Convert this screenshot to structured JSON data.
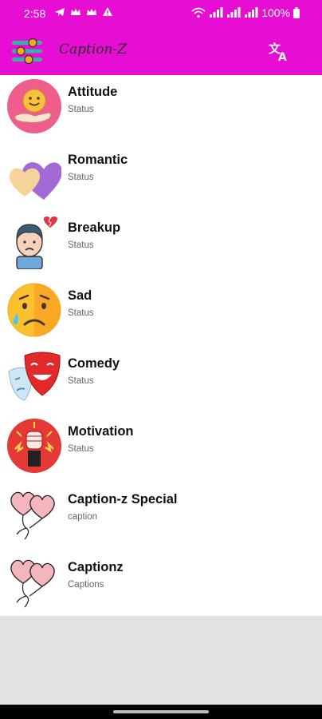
{
  "status_bar": {
    "time": "2:58",
    "battery": "100%"
  },
  "app_bar": {
    "title": "Caption-Z"
  },
  "list": [
    {
      "title": "Attitude",
      "subtitle": "Status",
      "icon": "smiley-hand-icon"
    },
    {
      "title": "Romantic",
      "subtitle": "Status",
      "icon": "hearts-icon"
    },
    {
      "title": "Breakup",
      "subtitle": "Status",
      "icon": "sad-boy-broken-heart-icon"
    },
    {
      "title": "Sad",
      "subtitle": "Status",
      "icon": "crying-face-icon"
    },
    {
      "title": "Comedy",
      "subtitle": "Status",
      "icon": "theater-masks-icon"
    },
    {
      "title": "Motivation",
      "subtitle": "Status",
      "icon": "raised-fist-icon"
    },
    {
      "title": "Caption-z Special",
      "subtitle": "caption",
      "icon": "heart-balloons-icon"
    },
    {
      "title": "Captionz",
      "subtitle": "Captions",
      "icon": "heart-balloons-icon"
    }
  ],
  "colors": {
    "accent": "#e60ed2",
    "empty_area": "#e3e3e3"
  }
}
